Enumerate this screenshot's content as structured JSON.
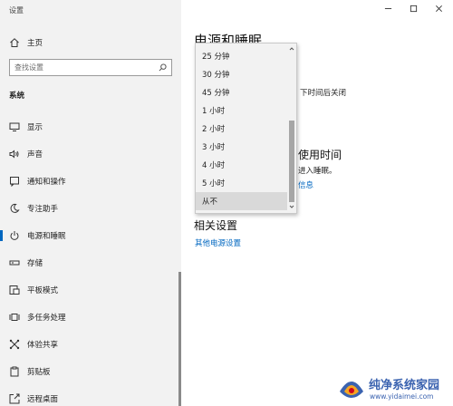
{
  "window": {
    "title": "设置"
  },
  "sidebar": {
    "home_label": "主页",
    "search_placeholder": "查找设置",
    "section_title": "系统",
    "items": [
      {
        "label": "显示",
        "icon": "display-icon"
      },
      {
        "label": "声音",
        "icon": "sound-icon"
      },
      {
        "label": "通知和操作",
        "icon": "notification-icon"
      },
      {
        "label": "专注助手",
        "icon": "focus-assist-icon"
      },
      {
        "label": "电源和睡眠",
        "icon": "power-icon",
        "selected": true
      },
      {
        "label": "存储",
        "icon": "storage-icon"
      },
      {
        "label": "平板模式",
        "icon": "tablet-mode-icon"
      },
      {
        "label": "多任务处理",
        "icon": "multitasking-icon"
      },
      {
        "label": "体验共享",
        "icon": "shared-experiences-icon"
      },
      {
        "label": "剪贴板",
        "icon": "clipboard-icon"
      },
      {
        "label": "远程桌面",
        "icon": "remote-desktop-icon"
      }
    ]
  },
  "main": {
    "page_title": "电源和睡眠",
    "screen_text_fragment": "下时间后关闭",
    "sleep_title_fragment": "使用时间",
    "sleep_text_fragment": "进入睡眠。",
    "info_link_fragment": "信息",
    "related_title": "相关设置",
    "related_link": "其他电源设置"
  },
  "dropdown": {
    "options": [
      "25 分钟",
      "30 分钟",
      "45 分钟",
      "1 小时",
      "2 小时",
      "3 小时",
      "4 小时",
      "5 小时",
      "从不"
    ],
    "selected": "从不",
    "scroll_position": 0.85
  },
  "watermark": {
    "title": "纯净系统家园",
    "url": "www.yidaimei.com"
  },
  "colors": {
    "accent": "#0067c0",
    "sidebar_bg": "#f2f2f2",
    "watermark": "#3b63b0"
  }
}
